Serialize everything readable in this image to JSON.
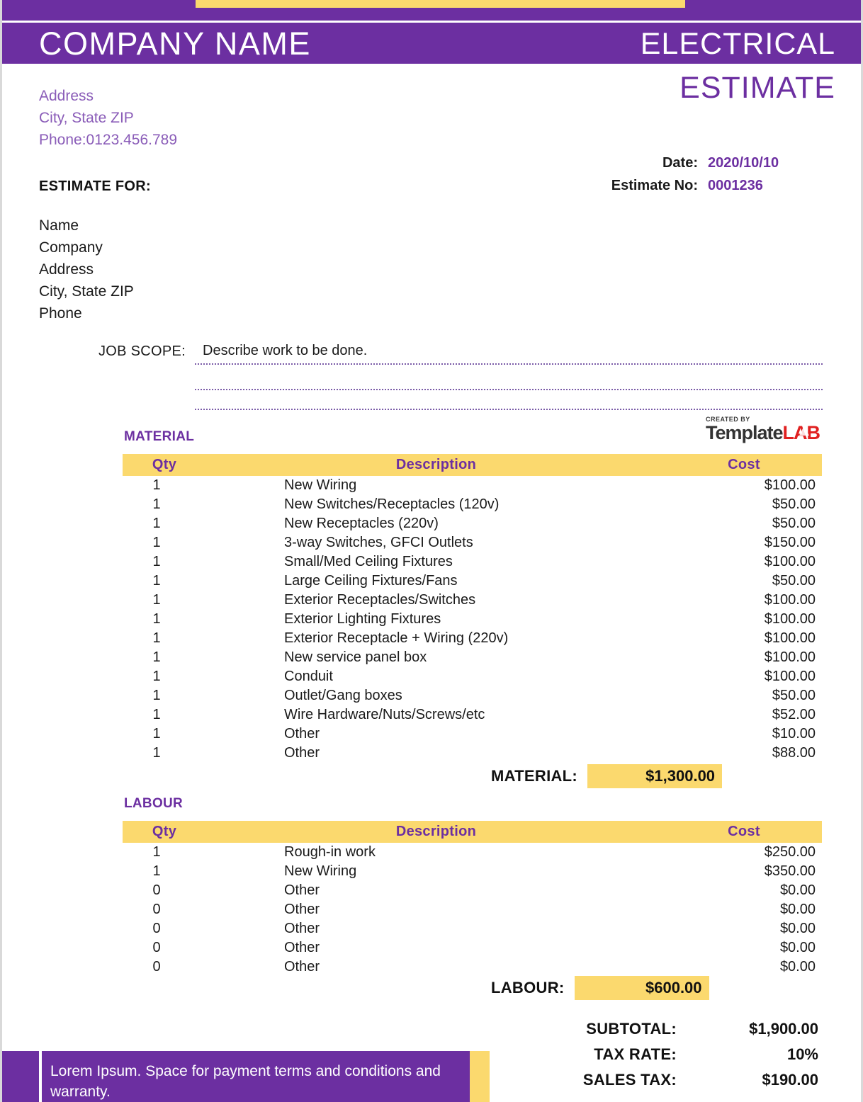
{
  "colors": {
    "purple": "#6C2FA1",
    "gold": "#FBD96E",
    "light_purple_text": "#8A5CB8",
    "logo_red": "#E02020"
  },
  "header": {
    "company_name": "COMPANY NAME",
    "doc_type_line1": "ELECTRICAL",
    "doc_type_line2": "ESTIMATE"
  },
  "sender": {
    "address": "Address",
    "city_state_zip": "City, State ZIP",
    "phone": "Phone:0123.456.789"
  },
  "meta": {
    "date_label": "Date:",
    "date_value": "2020/10/10",
    "estimate_no_label": "Estimate No:",
    "estimate_no_value": "0001236"
  },
  "recipient": {
    "heading": "ESTIMATE FOR:",
    "name": "Name",
    "company": "Company",
    "address": "Address",
    "city_state_zip": "City, State ZIP",
    "phone": "Phone"
  },
  "job_scope": {
    "label": "JOB SCOPE:",
    "value": "Describe work to be done."
  },
  "logo": {
    "created_by": "CREATED BY",
    "template": "Template",
    "lab": "LAB"
  },
  "material": {
    "section_title": "MATERIAL",
    "columns": [
      "Qty",
      "Description",
      "Cost"
    ],
    "rows": [
      {
        "qty": "1",
        "description": "New Wiring",
        "cost": "$100.00"
      },
      {
        "qty": "1",
        "description": "New Switches/Receptacles (120v)",
        "cost": "$50.00"
      },
      {
        "qty": "1",
        "description": "New Receptacles (220v)",
        "cost": "$50.00"
      },
      {
        "qty": "1",
        "description": "3-way Switches, GFCI Outlets",
        "cost": "$150.00"
      },
      {
        "qty": "1",
        "description": "Small/Med Ceiling Fixtures",
        "cost": "$100.00"
      },
      {
        "qty": "1",
        "description": "Large Ceiling Fixtures/Fans",
        "cost": "$50.00"
      },
      {
        "qty": "1",
        "description": "Exterior Receptacles/Switches",
        "cost": "$100.00"
      },
      {
        "qty": "1",
        "description": "Exterior Lighting Fixtures",
        "cost": "$100.00"
      },
      {
        "qty": "1",
        "description": "Exterior Receptacle + Wiring (220v)",
        "cost": "$100.00"
      },
      {
        "qty": "1",
        "description": "New service panel box",
        "cost": "$100.00"
      },
      {
        "qty": "1",
        "description": "Conduit",
        "cost": "$100.00"
      },
      {
        "qty": "1",
        "description": "Outlet/Gang boxes",
        "cost": "$50.00"
      },
      {
        "qty": "1",
        "description": "Wire Hardware/Nuts/Screws/etc",
        "cost": "$52.00"
      },
      {
        "qty": "1",
        "description": "Other",
        "cost": "$10.00"
      },
      {
        "qty": "1",
        "description": "Other",
        "cost": "$88.00"
      }
    ],
    "total_label": "MATERIAL:",
    "total_value": "$1,300.00"
  },
  "labour": {
    "section_title": "LABOUR",
    "columns": [
      "Qty",
      "Description",
      "Cost"
    ],
    "rows": [
      {
        "qty": "1",
        "description": "Rough-in work",
        "cost": "$250.00"
      },
      {
        "qty": "1",
        "description": "New Wiring",
        "cost": "$350.00"
      },
      {
        "qty": "0",
        "description": "Other",
        "cost": "$0.00"
      },
      {
        "qty": "0",
        "description": "Other",
        "cost": "$0.00"
      },
      {
        "qty": "0",
        "description": "Other",
        "cost": "$0.00"
      },
      {
        "qty": "0",
        "description": "Other",
        "cost": "$0.00"
      },
      {
        "qty": "0",
        "description": "Other",
        "cost": "$0.00"
      }
    ],
    "total_label": "LABOUR:",
    "total_value": "$600.00"
  },
  "summary": {
    "rows": [
      {
        "label": "SUBTOTAL:",
        "value": "$1,900.00"
      },
      {
        "label": "TAX RATE:",
        "value": "10%"
      },
      {
        "label": "SALES TAX:",
        "value": "$190.00"
      }
    ]
  },
  "footer": {
    "terms": "Lorem Ipsum. Space for payment terms and conditions and warranty."
  }
}
